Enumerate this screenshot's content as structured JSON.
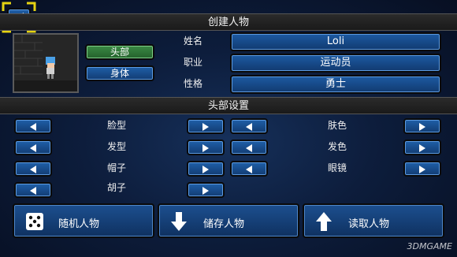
{
  "create": {
    "title": "创建人物",
    "tabs": [
      {
        "label": "头部"
      },
      {
        "label": "身体"
      }
    ],
    "fields": [
      {
        "label": "姓名",
        "value": "Loli"
      },
      {
        "label": "职业",
        "value": "运动员"
      },
      {
        "label": "性格",
        "value": "勇士"
      }
    ]
  },
  "head": {
    "title": "头部设置",
    "left_options": [
      "脸型",
      "发型",
      "帽子",
      "胡子"
    ],
    "right_options": [
      "肤色",
      "发色",
      "眼镜"
    ]
  },
  "actions": {
    "random": "随机人物",
    "save": "储存人物",
    "load": "读取人物"
  },
  "watermark": "3DMGAME",
  "colors": {
    "accent": "#1f5fa8",
    "selected": "#3b8a45",
    "focus": "#e6d312"
  }
}
